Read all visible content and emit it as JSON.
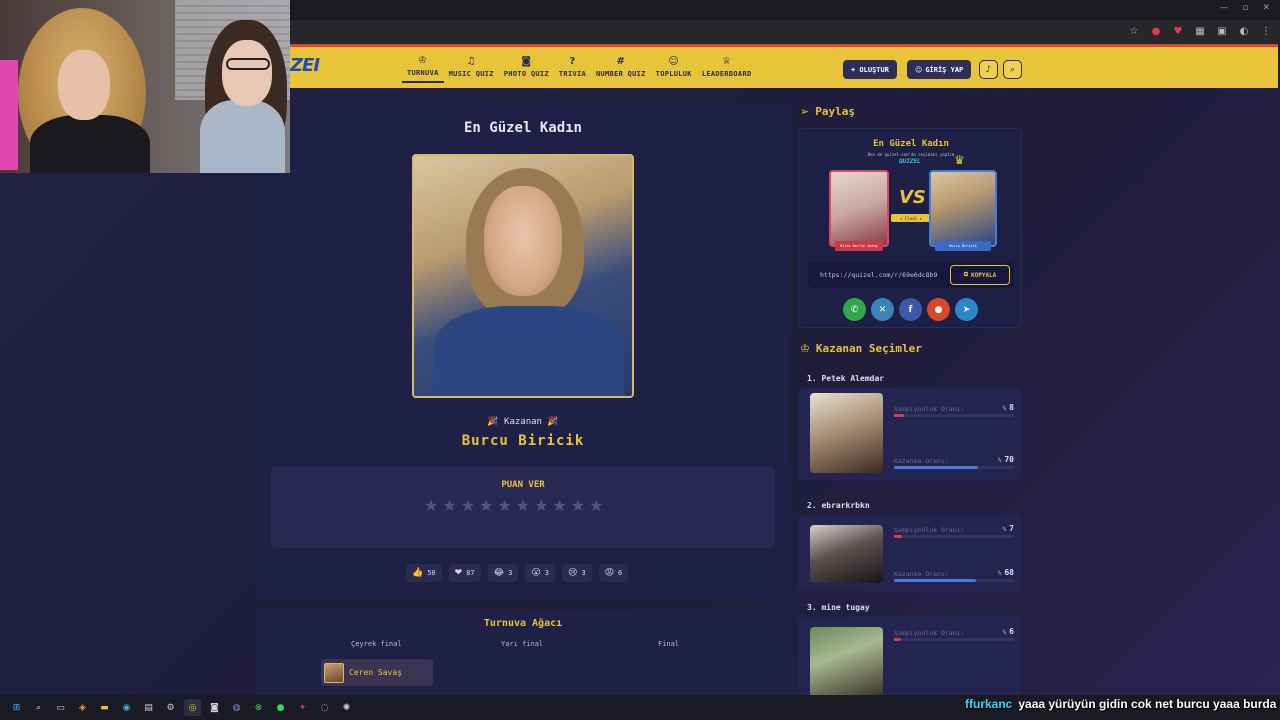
{
  "header": {
    "logo": "ZEI",
    "nav": [
      {
        "label": "TURNUVA",
        "icon": "♔",
        "active": true
      },
      {
        "label": "MUSIC QUIZ",
        "icon": "♫"
      },
      {
        "label": "PHOTO QUIZ",
        "icon": "◙"
      },
      {
        "label": "TRIVIA",
        "icon": "?"
      },
      {
        "label": "NUMBER QUIZ",
        "icon": "#"
      },
      {
        "label": "TOPLULUK",
        "icon": "☺"
      },
      {
        "label": "LEADERBOARD",
        "icon": "♕"
      }
    ],
    "create_label": "+ OLUŞTUR",
    "login_label": "GİRİŞ YAP",
    "bell_icon": "bell-icon",
    "search_icon": "search-icon"
  },
  "main": {
    "title": "En Güzel Kadın",
    "winner_label": "🎉 Kazanan 🎉",
    "winner_name": "Burcu Biricik",
    "rate_title": "PUAN VER",
    "stars_count": 10,
    "reactions": [
      {
        "emoji": "👍",
        "count": "50"
      },
      {
        "emoji": "❤",
        "count": "87"
      },
      {
        "emoji": "😂",
        "count": "3"
      },
      {
        "emoji": "😮",
        "count": "3"
      },
      {
        "emoji": "😢",
        "count": "3"
      },
      {
        "emoji": "😡",
        "count": "6"
      }
    ]
  },
  "bracket": {
    "title": "Turnuva Ağacı",
    "rounds": [
      "Çeyrek final",
      "Yarı final",
      "Final"
    ],
    "first_entry": "Ceren Savaş"
  },
  "share": {
    "heading": "Paylaş",
    "card_title": "En Güzel Kadın",
    "card_sub": "Ben de quizel.com'da seçimimi yaptım",
    "card_logo": "QUIZEL",
    "left_name": "Miles Berfin Aktay",
    "right_name": "Burcu Biricik",
    "vs": "VS",
    "final_tag": "★ Final ★",
    "url": "https://quizel.com/r/69e6dc8b9",
    "copy_label": "KOPYALA",
    "socials": [
      {
        "name": "whatsapp",
        "glyph": "✆",
        "color": "#2fa84a"
      },
      {
        "name": "x",
        "glyph": "✕",
        "color": "#3a84b8"
      },
      {
        "name": "facebook",
        "glyph": "f",
        "color": "#3a5aa8"
      },
      {
        "name": "reddit",
        "glyph": "●",
        "color": "#d8482a"
      },
      {
        "name": "telegram",
        "glyph": "➤",
        "color": "#2a88c8"
      }
    ]
  },
  "winners": {
    "heading": "Kazanan Seçimler",
    "champ_label": "Şampiyonluk Oranı:",
    "win_label": "Kazanma Oranı:",
    "items": [
      {
        "rank": "1.",
        "name": "Petek Alemdar",
        "champ": "8",
        "win": "70"
      },
      {
        "rank": "2.",
        "name": "ebrarkrbkn",
        "champ": "7",
        "win": "68"
      },
      {
        "rank": "3.",
        "name": "mine tugay",
        "champ": "6",
        "win": ""
      }
    ]
  },
  "chat": {
    "user": "ffurkanc",
    "message": "yaaa yürüyün gidin cok net burcu yaaa burda"
  }
}
